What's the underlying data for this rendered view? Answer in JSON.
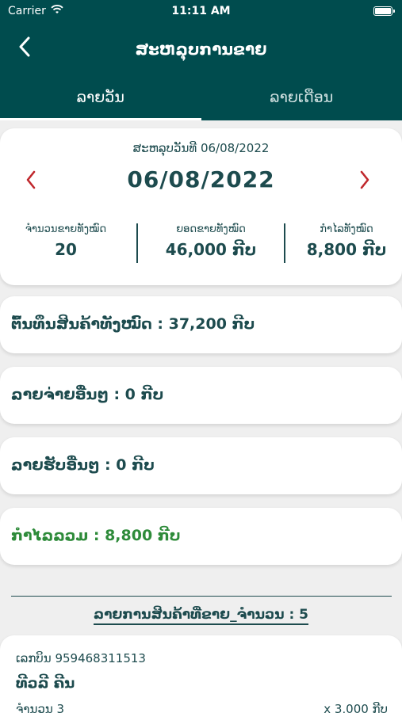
{
  "status_bar": {
    "carrier": "Carrier",
    "time": "11:11 AM"
  },
  "header": {
    "title": "ສະຫລຸບການຂາຍ"
  },
  "tabs": [
    {
      "label": "ລາຍວັນ",
      "active": true
    },
    {
      "label": "ລາຍເດືອນ",
      "active": false
    }
  ],
  "summary": {
    "caption": "ສະຫລຸບວັນທີ 06/08/2022",
    "date": "06/08/2022",
    "stats": [
      {
        "label": "ຈຳນວນຂາຍທັງໝົດ",
        "value": "20"
      },
      {
        "label": "ຍອດຂາຍທັງໝົດ",
        "value": "46,000 ກີບ"
      },
      {
        "label": "ກຳໄລທັງໝົດ",
        "value": "8,800 ກີບ"
      }
    ]
  },
  "lines": {
    "cost": "ຕົ້ນທຶນສິນຄ້າທັງໝົດ : 37,200 ກີບ",
    "other_expense": "ລາຍຈ່າຍອື່ນໆ : 0 ກີບ",
    "other_income": "ລາຍຮັບອື່ນໆ : 0 ກີບ",
    "net_profit": "ກຳໄລລວມ : 8,800 ກີບ"
  },
  "list": {
    "title": "ລາຍການສິນຄ້າທີ່ຂາຍ_ຈຳນວນ : 5",
    "items": [
      {
        "bill": "ເລກບິນ 959468311513",
        "name": "ທີວລີ ຄີນ",
        "qty": "ຈຳນວນ 3",
        "price": "x 3,000 ກີບ"
      }
    ]
  },
  "colors": {
    "primary": "#004c4e",
    "accent_red": "#c0282d",
    "profit_green": "#2e8b3a"
  },
  "icons": {
    "back": "chevron-left-icon",
    "prev": "chevron-left-icon",
    "next": "chevron-right-icon",
    "wifi": "wifi-icon",
    "battery": "battery-icon"
  }
}
